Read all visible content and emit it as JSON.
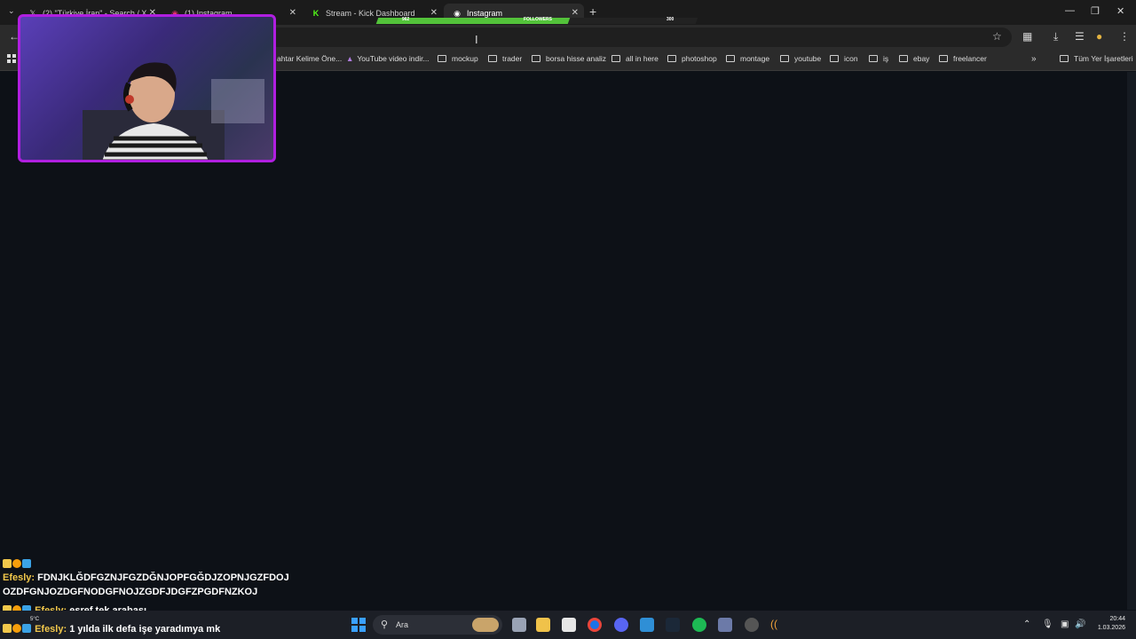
{
  "browser": {
    "tabs": [
      {
        "title": "(2) \"Türkiye İran\" - Search / X",
        "icon": "x-icon"
      },
      {
        "title": "(1) Instagram",
        "icon": "instagram-icon"
      },
      {
        "title": "Stream - Kick Dashboard",
        "icon": "kick-icon"
      },
      {
        "title": "Instagram",
        "icon": "instagram-icon",
        "active": true
      }
    ],
    "bookmarks": [
      "ahtar Kelime Öne...",
      "YouTube video indir...",
      "mockup",
      "trader",
      "borsa hisse analiz",
      "all in here",
      "photoshop",
      "montage",
      "youtube",
      "icon",
      "iş",
      "ebay",
      "freelancer"
    ],
    "all_bookmarks": "Tüm Yer İşaretleri"
  },
  "overlay": {
    "progress_current": "962",
    "progress_label": "FOLLOWERS",
    "progress_goal": "300",
    "progress_fraction": 0.6
  },
  "chat": {
    "messages": [
      {
        "user": "Efesly:",
        "text": "FDNJKLĞDFGZNJFGZDĞNJOPFGĞDJZOPNJGZFDOJ",
        "text2": "OZDFGNJOZDGFNODGFNOJZGDFJDGFZPGDFNZKOJ"
      },
      {
        "user": "Efesly:",
        "text": "eşref tek arabası"
      },
      {
        "user": "Efesly:",
        "text": "1 yılda ilk defa işe yaradımya mk"
      }
    ]
  },
  "taskbar": {
    "search_placeholder": "Ara",
    "weather": "5°C",
    "time": "20:44",
    "date": "1.03.2026"
  },
  "colors": {
    "accent_purple": "#b01fe0",
    "progress_green": "#53c23a",
    "chat_user": "#f2c84b",
    "page_bg": "#0d1117"
  }
}
